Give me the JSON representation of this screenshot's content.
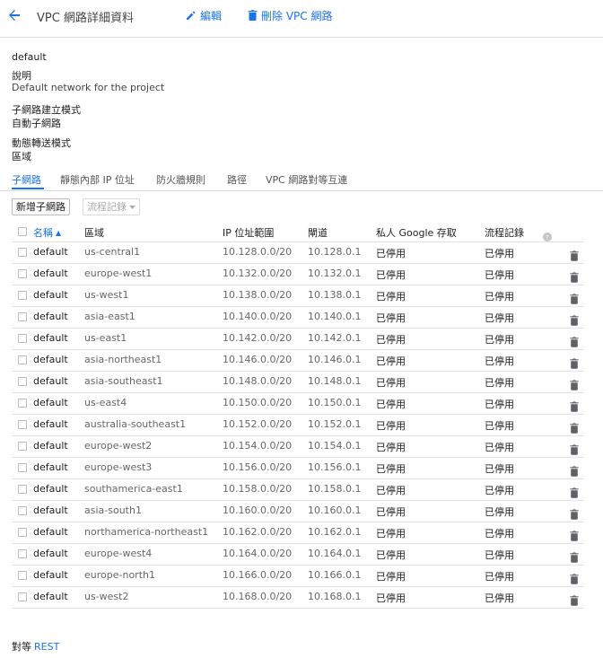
{
  "header": {
    "title": "VPC 網路詳細資料",
    "edit_label": "編輯",
    "delete_label": "刪除 VPC 網路"
  },
  "details": {
    "name": "default",
    "description_label": "說明",
    "description_value": "Default network for the project",
    "subnet_mode_label": "子網路建立模式",
    "subnet_mode_value": "自動子網路",
    "routing_mode_label": "動態轉送模式",
    "routing_mode_value": "區域"
  },
  "tabs": [
    {
      "label": "子網路",
      "active": true
    },
    {
      "label": "靜態內部 IP 位址",
      "active": false
    },
    {
      "label": "防火牆規則",
      "active": false
    },
    {
      "label": "路徑",
      "active": false
    },
    {
      "label": "VPC 網路對等互連",
      "active": false
    }
  ],
  "toolbar": {
    "add_subnet_label": "新增子網路",
    "flow_logs_label": "流程記錄"
  },
  "table": {
    "headers": {
      "name": "名稱",
      "region": "區域",
      "ip_range": "IP 位址範圍",
      "gateway": "閘道",
      "private_google_access": "私人 Google 存取",
      "flow_logs": "流程記錄"
    },
    "rows": [
      {
        "name": "default",
        "region": "us-central1",
        "ip_range": "10.128.0.0/20",
        "gateway": "10.128.0.1",
        "pga": "已停用",
        "flow": "已停用"
      },
      {
        "name": "default",
        "region": "europe-west1",
        "ip_range": "10.132.0.0/20",
        "gateway": "10.132.0.1",
        "pga": "已停用",
        "flow": "已停用"
      },
      {
        "name": "default",
        "region": "us-west1",
        "ip_range": "10.138.0.0/20",
        "gateway": "10.138.0.1",
        "pga": "已停用",
        "flow": "已停用"
      },
      {
        "name": "default",
        "region": "asia-east1",
        "ip_range": "10.140.0.0/20",
        "gateway": "10.140.0.1",
        "pga": "已停用",
        "flow": "已停用"
      },
      {
        "name": "default",
        "region": "us-east1",
        "ip_range": "10.142.0.0/20",
        "gateway": "10.142.0.1",
        "pga": "已停用",
        "flow": "已停用"
      },
      {
        "name": "default",
        "region": "asia-northeast1",
        "ip_range": "10.146.0.0/20",
        "gateway": "10.146.0.1",
        "pga": "已停用",
        "flow": "已停用"
      },
      {
        "name": "default",
        "region": "asia-southeast1",
        "ip_range": "10.148.0.0/20",
        "gateway": "10.148.0.1",
        "pga": "已停用",
        "flow": "已停用"
      },
      {
        "name": "default",
        "region": "us-east4",
        "ip_range": "10.150.0.0/20",
        "gateway": "10.150.0.1",
        "pga": "已停用",
        "flow": "已停用"
      },
      {
        "name": "default",
        "region": "australia-southeast1",
        "ip_range": "10.152.0.0/20",
        "gateway": "10.152.0.1",
        "pga": "已停用",
        "flow": "已停用"
      },
      {
        "name": "default",
        "region": "europe-west2",
        "ip_range": "10.154.0.0/20",
        "gateway": "10.154.0.1",
        "pga": "已停用",
        "flow": "已停用"
      },
      {
        "name": "default",
        "region": "europe-west3",
        "ip_range": "10.156.0.0/20",
        "gateway": "10.156.0.1",
        "pga": "已停用",
        "flow": "已停用"
      },
      {
        "name": "default",
        "region": "southamerica-east1",
        "ip_range": "10.158.0.0/20",
        "gateway": "10.158.0.1",
        "pga": "已停用",
        "flow": "已停用"
      },
      {
        "name": "default",
        "region": "asia-south1",
        "ip_range": "10.160.0.0/20",
        "gateway": "10.160.0.1",
        "pga": "已停用",
        "flow": "已停用"
      },
      {
        "name": "default",
        "region": "northamerica-northeast1",
        "ip_range": "10.162.0.0/20",
        "gateway": "10.162.0.1",
        "pga": "已停用",
        "flow": "已停用"
      },
      {
        "name": "default",
        "region": "europe-west4",
        "ip_range": "10.164.0.0/20",
        "gateway": "10.164.0.1",
        "pga": "已停用",
        "flow": "已停用"
      },
      {
        "name": "default",
        "region": "europe-north1",
        "ip_range": "10.166.0.0/20",
        "gateway": "10.166.0.1",
        "pga": "已停用",
        "flow": "已停用"
      },
      {
        "name": "default",
        "region": "us-west2",
        "ip_range": "10.168.0.0/20",
        "gateway": "10.168.0.1",
        "pga": "已停用",
        "flow": "已停用"
      }
    ]
  },
  "footer": {
    "equivalent_label": "對等",
    "rest_link": "REST"
  },
  "colors": {
    "accent": "#1a73e8",
    "divider": "#dadada",
    "icon_gray": "#5f6368"
  },
  "icons": {
    "back": "arrow-back-icon",
    "edit": "pencil-icon",
    "delete": "trash-icon",
    "help": "help-icon",
    "dropdown": "chevron-down-icon",
    "sort": "sort-ascending-icon"
  }
}
